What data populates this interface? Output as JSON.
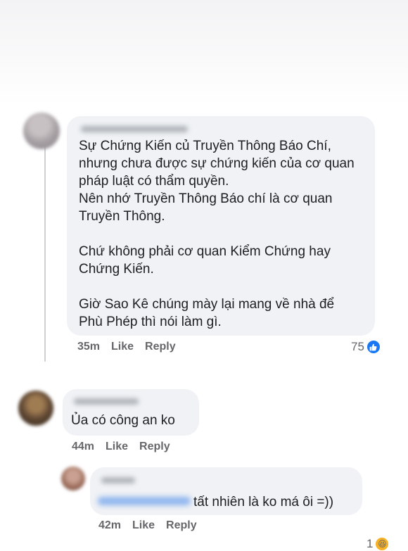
{
  "comments": [
    {
      "text": "Sự Chứng Kiến củ Truyền Thông Báo Chí,\nnhưng chưa được sự chứng kiến của cơ quan\npháp luật có thẩm quyền.\nNên nhớ Truyền Thông Báo chí là cơ quan\nTruyền Thông.\n\nChứ không phải cơ quan Kiểm Chứng hay\nChứng Kiến.\n\nGiờ Sao Kê chúng mày lại mang về nhà để\nPhù Phép thì nói làm gì.",
      "time": "35m",
      "like_label": "Like",
      "reply_label": "Reply",
      "reaction_count": "75",
      "reaction_icon": "like-icon"
    },
    {
      "text": "Ủa có công an ko",
      "time": "44m",
      "like_label": "Like",
      "reply_label": "Reply"
    },
    {
      "text": "tất nhiên là ko má ôi =))",
      "time": "42m",
      "like_label": "Like",
      "reply_label": "Reply",
      "reaction_count": "1",
      "reaction_icon": "haha-icon"
    }
  ],
  "colors": {
    "bubble": "#f0f2f5",
    "meta_text": "#65676b",
    "like_blue": "#1877f2",
    "haha_yellow": "#f7b125",
    "thread_line": "#ced0d4"
  }
}
